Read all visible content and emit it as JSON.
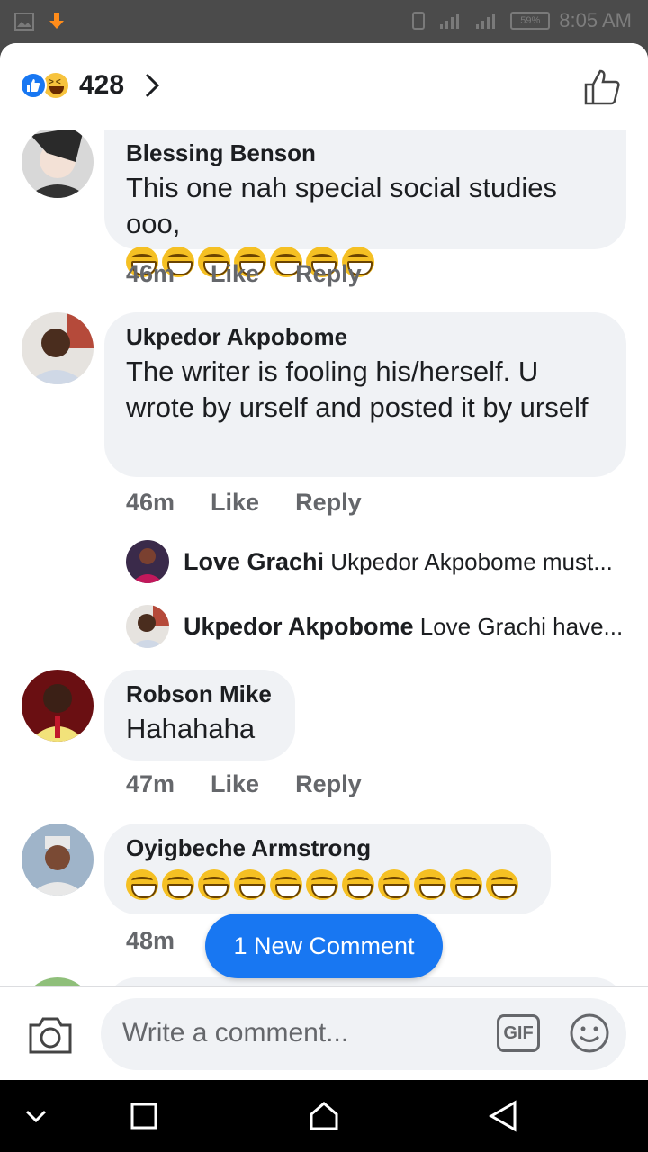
{
  "status_bar": {
    "time": "8:05 AM",
    "battery": "59%"
  },
  "header": {
    "reaction_count": "428"
  },
  "comments": [
    {
      "author": "Blessing Benson",
      "text": "This one nah special social studies ooo,",
      "emoji_count": 7,
      "time": "46m",
      "like": "Like",
      "reply": "Reply"
    },
    {
      "author": "Ukpedor Akpobome",
      "text": "The writer is fooling his/herself. U wrote by urself and posted it by urself",
      "time": "46m",
      "like": "Like",
      "reply": "Reply"
    },
    {
      "author": "Robson Mike",
      "text": "Hahahaha",
      "time": "47m",
      "like": "Like",
      "reply": "Reply"
    },
    {
      "author": "Oyigbeche Armstrong",
      "text": "",
      "emoji_count": 11,
      "time": "48m"
    }
  ],
  "replies": [
    {
      "author": "Love Grachi",
      "text": "Ukpedor Akpobome must..."
    },
    {
      "author": "Ukpedor Akpobome",
      "text": "Love Grachi have..."
    }
  ],
  "new_comment_label": "1 New Comment",
  "composer": {
    "placeholder": "Write a comment...",
    "gif_label": "GIF"
  },
  "colors": {
    "accent": "#1877f2",
    "bubble": "#f0f2f5",
    "meta": "#65676b"
  }
}
